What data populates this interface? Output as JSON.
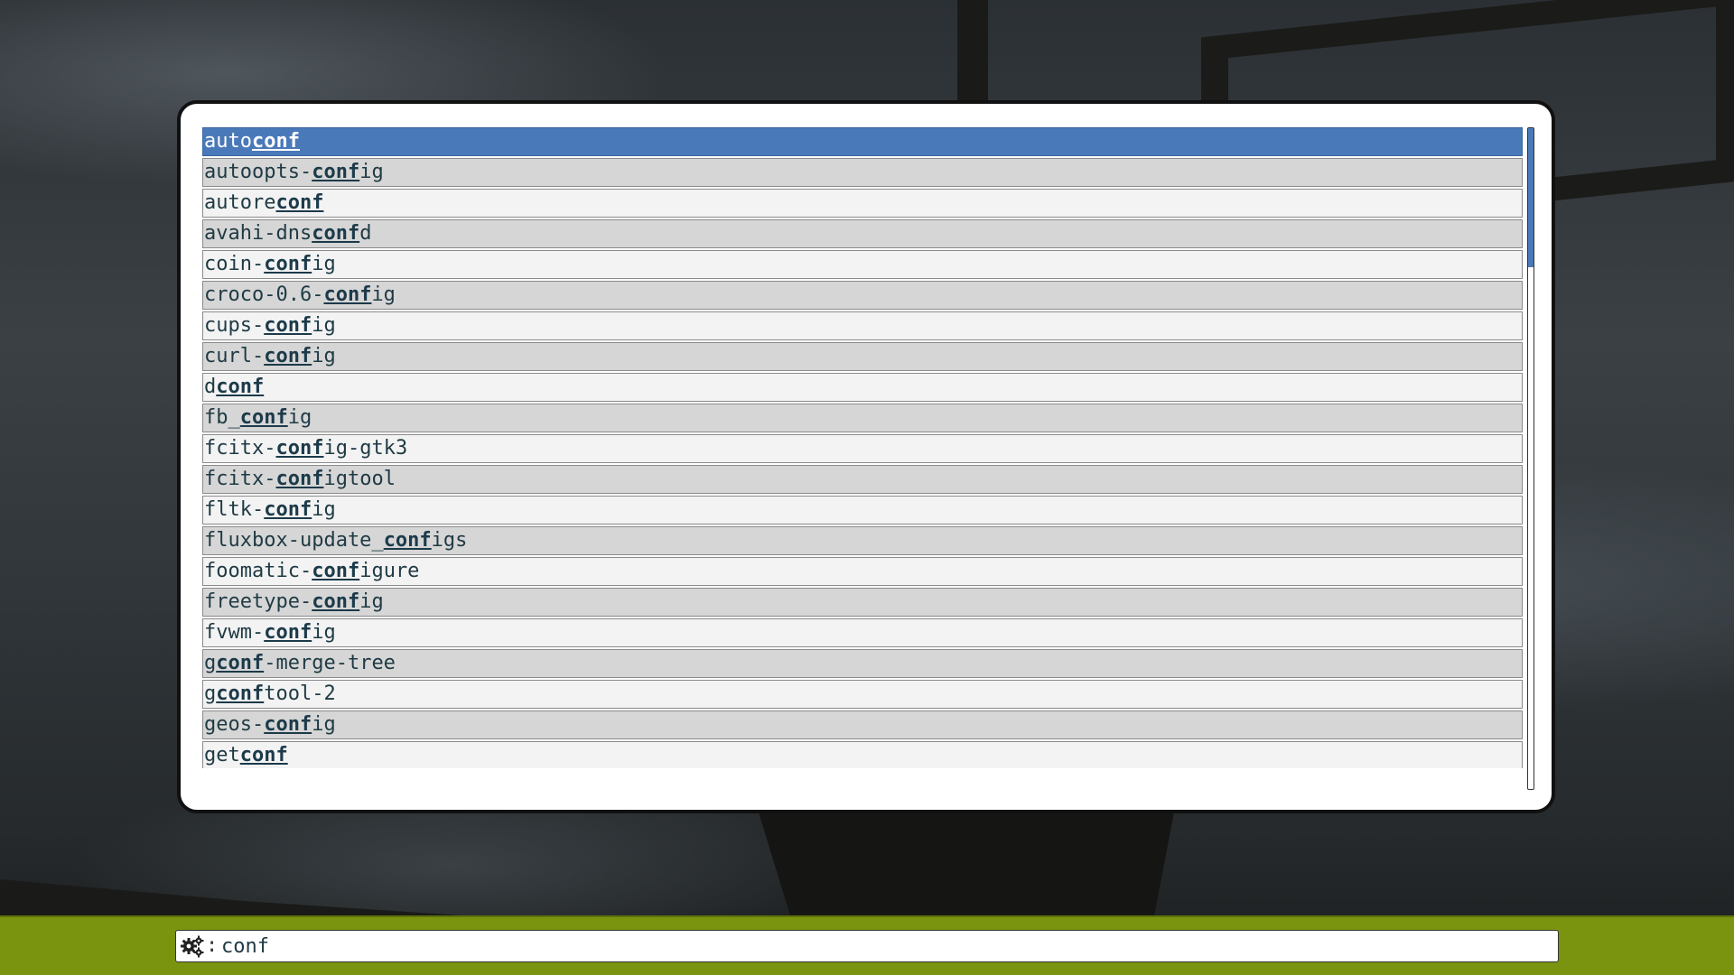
{
  "launcher": {
    "prompt_separator": ":",
    "query": "conf",
    "mode_icon": "gears-icon",
    "selected_index": 0,
    "items": [
      {
        "pre": "auto",
        "match": "conf",
        "post": ""
      },
      {
        "pre": "autoopts-",
        "match": "conf",
        "post": "ig"
      },
      {
        "pre": "autore",
        "match": "conf",
        "post": ""
      },
      {
        "pre": "avahi-dns",
        "match": "conf",
        "post": "d"
      },
      {
        "pre": "coin-",
        "match": "conf",
        "post": "ig"
      },
      {
        "pre": "croco-0.6-",
        "match": "conf",
        "post": "ig"
      },
      {
        "pre": "cups-",
        "match": "conf",
        "post": "ig"
      },
      {
        "pre": "curl-",
        "match": "conf",
        "post": "ig"
      },
      {
        "pre": "d",
        "match": "conf",
        "post": ""
      },
      {
        "pre": "fb_",
        "match": "conf",
        "post": "ig"
      },
      {
        "pre": "fcitx-",
        "match": "conf",
        "post": "ig-gtk3"
      },
      {
        "pre": "fcitx-",
        "match": "conf",
        "post": "igtool"
      },
      {
        "pre": "fltk-",
        "match": "conf",
        "post": "ig"
      },
      {
        "pre": "fluxbox-update_",
        "match": "conf",
        "post": "igs"
      },
      {
        "pre": "foomatic-",
        "match": "conf",
        "post": "igure"
      },
      {
        "pre": "freetype-",
        "match": "conf",
        "post": "ig"
      },
      {
        "pre": "fvwm-",
        "match": "conf",
        "post": "ig"
      },
      {
        "pre": "g",
        "match": "conf",
        "post": "-merge-tree"
      },
      {
        "pre": "g",
        "match": "conf",
        "post": "tool-2"
      },
      {
        "pre": "geos-",
        "match": "conf",
        "post": "ig"
      },
      {
        "pre": "get",
        "match": "conf",
        "post": ""
      }
    ],
    "scroll_fraction": 0.21
  },
  "colors": {
    "selected_bg": "#4a79b9",
    "row_even": "#f3f3f3",
    "row_odd": "#d6d6d6",
    "bar_bg": "#7a9410"
  }
}
